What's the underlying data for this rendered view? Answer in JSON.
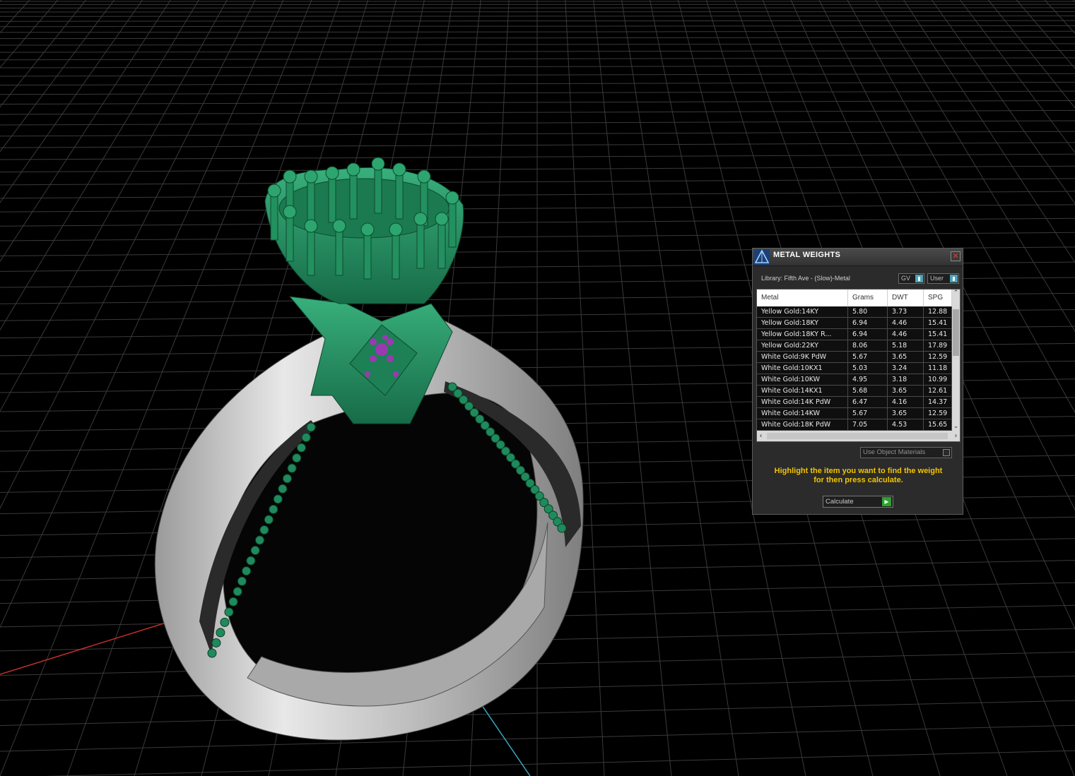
{
  "panel": {
    "title": "METAL WEIGHTS",
    "close_glyph": "✕",
    "library_label": "Library: Fifth Ave - (Slow)-Metal",
    "gv_dropdown": "GV",
    "user_dropdown": "User",
    "table": {
      "headers": [
        "Metal",
        "Grams",
        "DWT",
        "SPG"
      ],
      "rows": [
        [
          "Yellow Gold:14KY",
          "5.80",
          "3.73",
          "12.88"
        ],
        [
          "Yellow Gold:18KY",
          "6.94",
          "4.46",
          "15.41"
        ],
        [
          "Yellow Gold:18KY R...",
          "6.94",
          "4.46",
          "15.41"
        ],
        [
          "Yellow Gold:22KY",
          "8.06",
          "5.18",
          "17.89"
        ],
        [
          "White Gold:9K PdW",
          "5.67",
          "3.65",
          "12.59"
        ],
        [
          "White Gold:10KX1",
          "5.03",
          "3.24",
          "11.18"
        ],
        [
          "White Gold:10KW",
          "4.95",
          "3.18",
          "10.99"
        ],
        [
          "White Gold:14KX1",
          "5.68",
          "3.65",
          "12.61"
        ],
        [
          "White Gold:14K PdW",
          "6.47",
          "4.16",
          "14.37"
        ],
        [
          "White Gold:14KW",
          "5.67",
          "3.65",
          "12.59"
        ],
        [
          "White Gold:18K PdW",
          "7.05",
          "4.53",
          "15.65"
        ]
      ]
    },
    "use_object_materials": "Use Object Materials",
    "hint_line1": "Highlight the item you want to find the weight",
    "hint_line2": "for then press calculate.",
    "calculate_label": "Calculate"
  },
  "colors": {
    "background": "#000000",
    "grid": "#3a3a3a",
    "axis_x": "#c0302a",
    "axis_y": "#3aa6c0",
    "ring_metal": "#c9c9c9",
    "ring_green": "#1f8a5c",
    "gem_purple": "#9a3ab0",
    "hint_text": "#f2c400"
  },
  "icons": [
    "app-logo-icon",
    "close-icon",
    "dropdown-arrow-icon",
    "scroll-up-icon",
    "scroll-down-icon",
    "scroll-left-icon",
    "scroll-right-icon",
    "play-icon",
    "checkbox-icon"
  ]
}
